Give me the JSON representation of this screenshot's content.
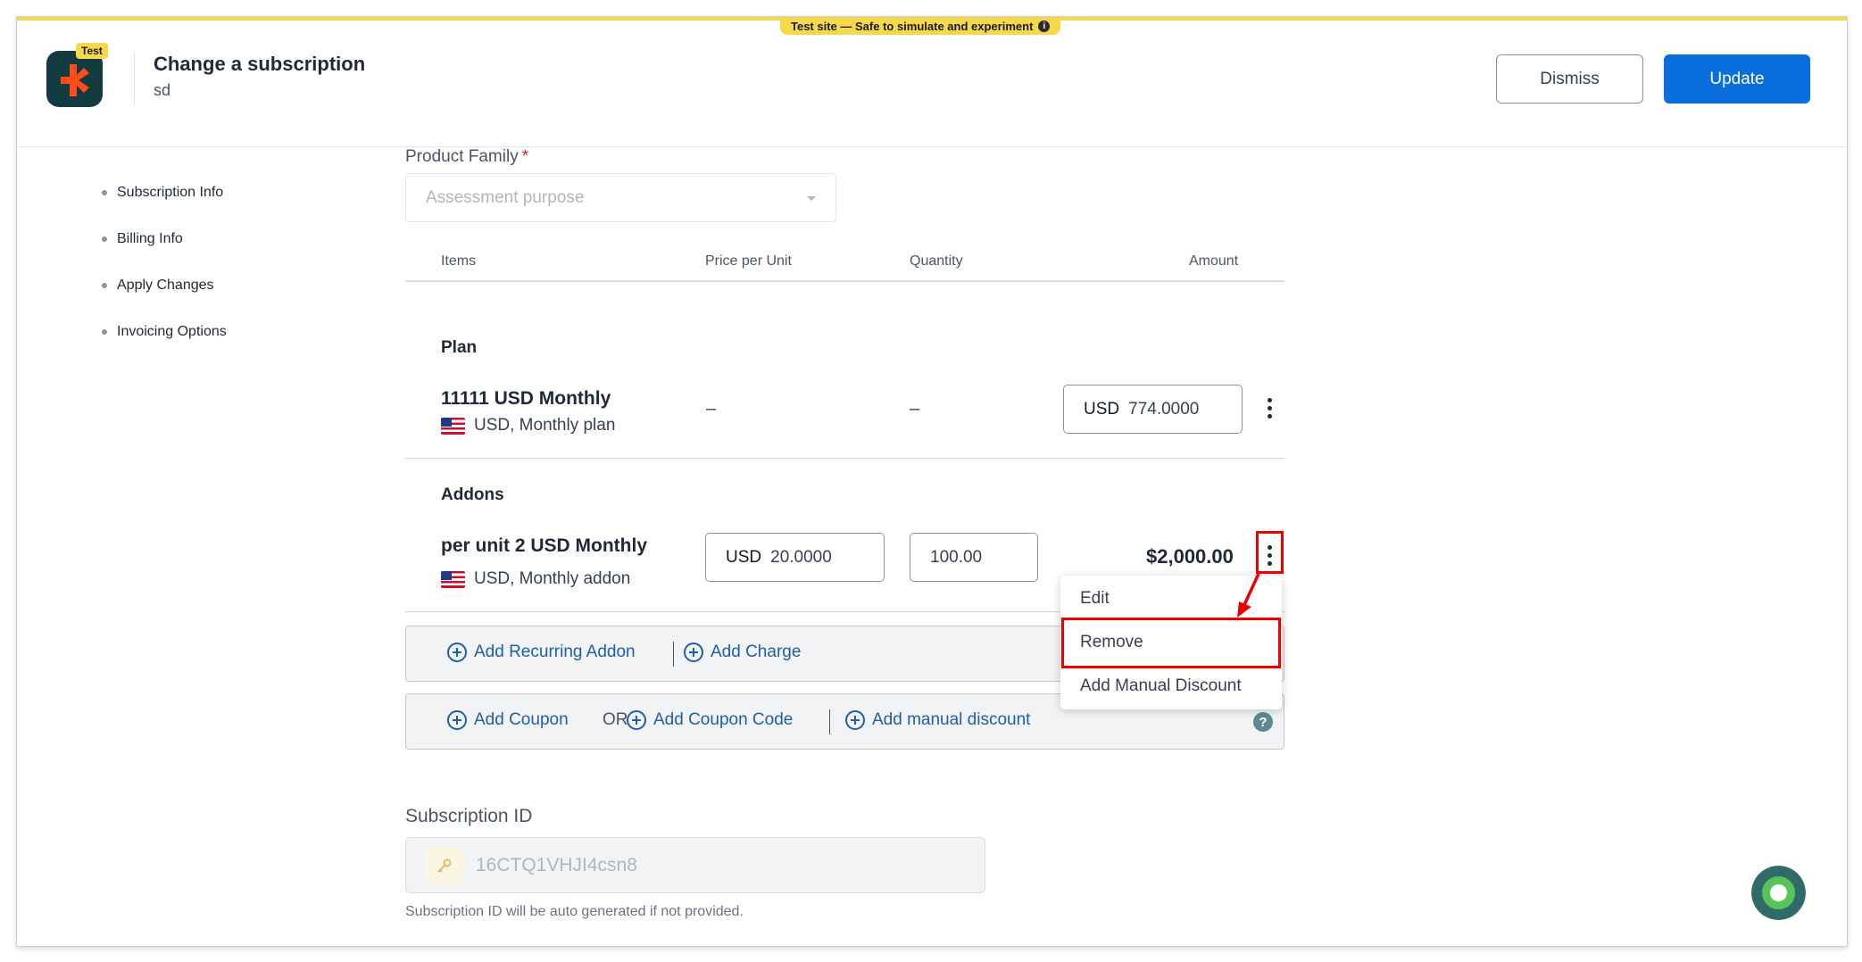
{
  "banner": {
    "text": "Test site — Safe to simulate and experiment",
    "info_icon": "i"
  },
  "header": {
    "logo_icon": "chargebee-logo-icon",
    "test_tag": "Test",
    "title": "Change a subscription",
    "subtitle": "sd",
    "dismiss_label": "Dismiss",
    "update_label": "Update"
  },
  "sidebar": {
    "items": [
      {
        "label": "Subscription Info"
      },
      {
        "label": "Billing Info"
      },
      {
        "label": "Apply Changes"
      },
      {
        "label": "Invoicing Options"
      }
    ]
  },
  "product_family": {
    "label": "Product Family",
    "required_mark": "*",
    "placeholder": "Assessment purpose"
  },
  "table": {
    "headers": {
      "items": "Items",
      "price": "Price per Unit",
      "quantity": "Quantity",
      "amount": "Amount"
    },
    "plan": {
      "section": "Plan",
      "name": "11111 USD Monthly",
      "sub": "USD, Monthly plan",
      "price": "–",
      "quantity": "–",
      "amount_currency": "USD",
      "amount_value": "774.0000"
    },
    "addons": {
      "section": "Addons",
      "name": "per unit 2 USD Monthly",
      "sub": "USD, Monthly addon",
      "price_currency": "USD",
      "price_value": "20.0000",
      "quantity_value": "100.00",
      "amount": "$2,000.00"
    }
  },
  "actions": {
    "add_recurring_addon": "Add Recurring Addon",
    "add_charge": "Add Charge",
    "add_coupon": "Add Coupon",
    "or": "OR",
    "add_coupon_code": "Add Coupon Code",
    "add_manual_discount": "Add manual discount",
    "help_icon": "?"
  },
  "context_menu": {
    "items": [
      {
        "label": "Edit"
      },
      {
        "label": "Remove"
      },
      {
        "label": "Add Manual Discount"
      }
    ]
  },
  "subscription_id": {
    "label": "Subscription ID",
    "placeholder": "16CTQ1VHJI4csn8",
    "hint": "Subscription ID will be auto generated if not provided."
  },
  "colors": {
    "primary": "#0a6fdc",
    "link": "#1f5fa8",
    "highlight": "#ee0000",
    "banner": "#f6d94a"
  }
}
